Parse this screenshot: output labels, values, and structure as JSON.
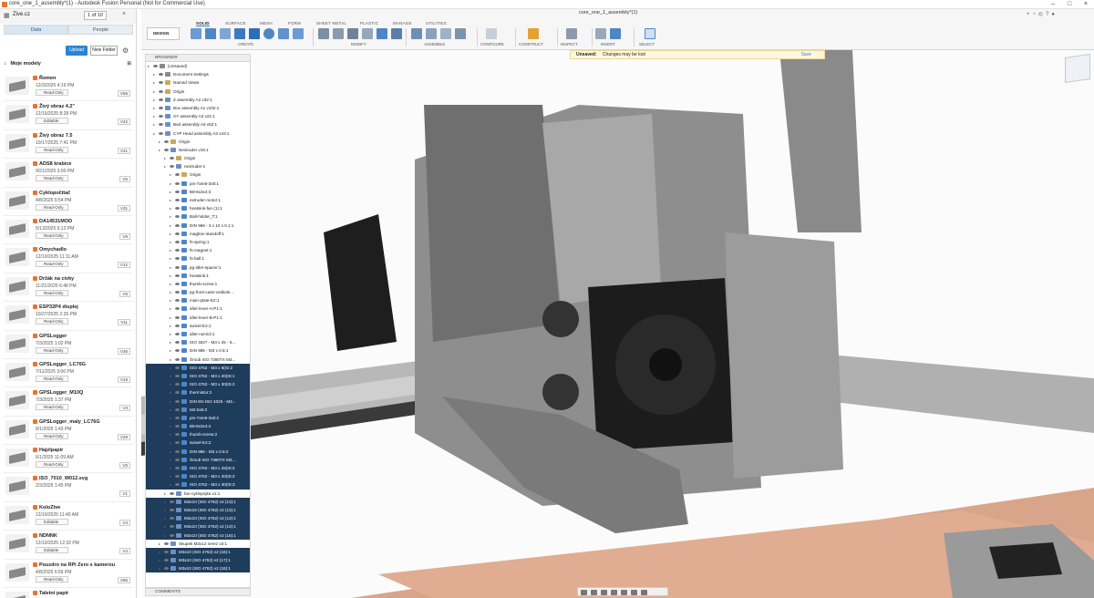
{
  "window": {
    "title": "core_one_1_assembly*(1) - Autodesk Fusion Personal (Not for Commercial Use)",
    "doc_tab": "core_one_1_assembly*(1)"
  },
  "datapanel": {
    "hub": "Zive.cz",
    "pager": "1 of 10",
    "tabs": [
      "Data",
      "People"
    ],
    "upload": "Upload",
    "new_folder": "New Folder",
    "crumb": "Moje modely",
    "items": [
      {
        "name": "Řemen",
        "date": "12/3/2025 4:19 PM",
        "access": "Read-Only",
        "ver": "V66"
      },
      {
        "name": "Živý obraz 4.2\"",
        "date": "12/15/2025 8:28 PM",
        "access": "Editable",
        "ver": "V42"
      },
      {
        "name": "Živý obraz 7.5",
        "date": "10/17/2025 7:41 PM",
        "access": "Read-Only",
        "ver": "V21"
      },
      {
        "name": "ADS8 krabice",
        "date": "9/21/2025 3:00 PM",
        "access": "Read-Only",
        "ver": "V5"
      },
      {
        "name": "Cyklopočítač",
        "date": "4/8/2025 6:54 PM",
        "access": "Read-Only",
        "ver": "V31"
      },
      {
        "name": "DA14531MOD",
        "date": "5/13/2025 6:12 PM",
        "access": "Read-Only",
        "ver": "V9"
      },
      {
        "name": "Omychadlo",
        "date": "12/10/2025 11:11 AM",
        "access": "Read-Only",
        "ver": "V12"
      },
      {
        "name": "Držák na cívky",
        "date": "11/21/2025 6:48 PM",
        "access": "Read-Only",
        "ver": "V6"
      },
      {
        "name": "ESP32P4 displej",
        "date": "10/27/2025 2:26 PM",
        "access": "Read-Only",
        "ver": "V11"
      },
      {
        "name": "GPSLogger",
        "date": "7/3/2025 1:02 PM",
        "access": "Read-Only",
        "ver": "V36"
      },
      {
        "name": "GPSLogger_LC76G",
        "date": "7/11/2025 3:06 PM",
        "access": "Read-Only",
        "ver": "V19"
      },
      {
        "name": "GPSLogger_M10Q",
        "date": "7/3/2025 1:37 PM",
        "access": "Read-Only",
        "ver": "V3"
      },
      {
        "name": "GPSLogger_maly_LC76G",
        "date": "8/1/2025 1:43 PM",
        "access": "Read-Only",
        "ver": "V29"
      },
      {
        "name": "Hajzlpapír",
        "date": "6/1/2025 11:09 AM",
        "access": "Read-Only",
        "ver": "V5"
      },
      {
        "name": "ISO_7010_W012.svg",
        "date": "2/3/2025 1:45 PM",
        "access": "",
        "ver": "V1"
      },
      {
        "name": "KoloZive",
        "date": "12/10/2025 11:40 AM",
        "access": "Editable",
        "ver": "V4"
      },
      {
        "name": "NDNNK",
        "date": "12/10/2025 12:32 PM",
        "access": "Editable",
        "ver": "V4"
      },
      {
        "name": "Pouzdro na RPi Zero s kamerou",
        "date": "4/8/2025 6:55 PM",
        "access": "Read-Only",
        "ver": "V66"
      },
      {
        "name": "Taletní papír",
        "date": "5/17/2025 4:05 PM",
        "access": "",
        "ver": ""
      }
    ]
  },
  "toolbar": {
    "workspace": "DESIGN",
    "tabs": [
      "SOLID",
      "SURFACE",
      "MESH",
      "FORM",
      "SHEET METAL",
      "PLASTIC",
      "MANAGE",
      "UTILITIES"
    ],
    "groups": [
      "CREATE",
      "MODIFY",
      "ASSEMBLE",
      "CONFIGURE",
      "CONSTRUCT",
      "INSPECT",
      "INSERT",
      "SELECT"
    ]
  },
  "banner": {
    "state": "Unsaved:",
    "msg": "Changes may be lost",
    "save": "Save"
  },
  "browser": {
    "title": "BROWSER",
    "comments": "COMMENTS",
    "rows": [
      {
        "label": "(Unsaved)",
        "indent": 0,
        "icon": "root"
      },
      {
        "label": "Document Settings",
        "indent": 1,
        "icon": "gear"
      },
      {
        "label": "Named Views",
        "indent": 1,
        "icon": "folder"
      },
      {
        "label": "Origin",
        "indent": 1,
        "icon": "folder"
      },
      {
        "label": "Z assembly A2 v32:1",
        "indent": 1,
        "icon": "comp"
      },
      {
        "label": "Box assembly A1 v102:1",
        "indent": 1,
        "icon": "comp"
      },
      {
        "label": "XY assembly A3 v21:1",
        "indent": 1,
        "icon": "comp"
      },
      {
        "label": "Bed assembly A5 v52:1",
        "indent": 1,
        "icon": "comp"
      },
      {
        "label": "CYP Head assembly A3 v43:1",
        "indent": 1,
        "icon": "comp"
      },
      {
        "label": "Origin",
        "indent": 2,
        "icon": "folder"
      },
      {
        "label": "Nextruder v16:1",
        "indent": 2,
        "icon": "comp"
      },
      {
        "label": "Origin",
        "indent": 3,
        "icon": "folder"
      },
      {
        "label": "nextruder:1",
        "indent": 3,
        "icon": "comp"
      },
      {
        "label": "Origin",
        "indent": 4,
        "icon": "folder"
      },
      {
        "label": "pin-7am6-3x8:1",
        "indent": 4,
        "icon": "body"
      },
      {
        "label": "B8-8x3x4:3",
        "indent": 4,
        "icon": "body"
      },
      {
        "label": "extruder-motor:1",
        "indent": 4,
        "icon": "body"
      },
      {
        "label": "heatsink-fan (1):1",
        "indent": 4,
        "icon": "body"
      },
      {
        "label": "Ball-holder_T:1",
        "indent": 4,
        "icon": "body"
      },
      {
        "label": "DIN 968 - 3 x 10 x 0.1:1",
        "indent": 4,
        "icon": "body"
      },
      {
        "label": "magbox-standoff:1",
        "indent": 4,
        "icon": "body"
      },
      {
        "label": "fs-spring:1",
        "indent": 4,
        "icon": "body"
      },
      {
        "label": "fs-magnet:1",
        "indent": 4,
        "icon": "body"
      },
      {
        "label": "fs-ball:1",
        "indent": 4,
        "icon": "body"
      },
      {
        "label": "pg-idler-spacer:1",
        "indent": 4,
        "icon": "body"
      },
      {
        "label": "heatsink:1",
        "indent": 4,
        "icon": "body"
      },
      {
        "label": "thumb-screw:1",
        "indent": 4,
        "icon": "body"
      },
      {
        "label": "pg-front-case-votikole...",
        "indent": 4,
        "icon": "body"
      },
      {
        "label": "main-plate-E2:1",
        "indent": 4,
        "icon": "body"
      },
      {
        "label": "idler-lever-A-P1:1",
        "indent": 4,
        "icon": "body"
      },
      {
        "label": "idler-lever-B-P1:1",
        "indent": 4,
        "icon": "body"
      },
      {
        "label": "swivel-E2:1",
        "indent": 4,
        "icon": "body"
      },
      {
        "label": "idler-nut-E2:1",
        "indent": 4,
        "icon": "body"
      },
      {
        "label": "ISO 4027 - M3 x 25 - 6...",
        "indent": 4,
        "icon": "body"
      },
      {
        "label": "DIN 985 - M3 x 0.5:1",
        "indent": 4,
        "icon": "body"
      },
      {
        "label": "Šroub ISO 7380TX M3...",
        "indent": 4,
        "icon": "body"
      },
      {
        "label": "ISO 4762 - M3 x 8(IS:2",
        "indent": 4,
        "icon": "body",
        "sel": true
      },
      {
        "label": "ISO 4762 - M3 x 20(IS:1",
        "indent": 4,
        "icon": "body",
        "sel": true
      },
      {
        "label": "ISO 4762 - M3 x 30(IS:2",
        "indent": 4,
        "icon": "body",
        "sel": true
      },
      {
        "label": "thermistor:2",
        "indent": 4,
        "icon": "body",
        "sel": true
      },
      {
        "label": "DIN EN ISO 4026 - M3...",
        "indent": 4,
        "icon": "body",
        "sel": true
      },
      {
        "label": "M3 5x6:3",
        "indent": 4,
        "icon": "body",
        "sel": true
      },
      {
        "label": "pin-7am6-3x8:2",
        "indent": 4,
        "icon": "body",
        "sel": true
      },
      {
        "label": "B8-8x3x4:4",
        "indent": 4,
        "icon": "body",
        "sel": true
      },
      {
        "label": "thumb-screw:2",
        "indent": 4,
        "icon": "body",
        "sel": true
      },
      {
        "label": "swivel-E2:2",
        "indent": 4,
        "icon": "body",
        "sel": true
      },
      {
        "label": "DIN 985 - M3 x 0.5:2",
        "indent": 4,
        "icon": "body",
        "sel": true
      },
      {
        "label": "Šroub ISO 7380TX M3...",
        "indent": 4,
        "icon": "body",
        "sel": true
      },
      {
        "label": "ISO 4762 - M3 x 25(IS:2",
        "indent": 4,
        "icon": "body",
        "sel": true
      },
      {
        "label": "ISO 4762 - M3 x 20(IS:2",
        "indent": 4,
        "icon": "body",
        "sel": true
      },
      {
        "label": "ISO 4762 - M3 x 30(IS:3",
        "indent": 4,
        "icon": "body",
        "sel": true
      },
      {
        "label": "fan-cyklopojka v1:1",
        "indent": 3,
        "icon": "comp"
      },
      {
        "label": "M3x10 (ISO 4762) v2 (13):1",
        "indent": 3,
        "icon": "comp",
        "sel": true
      },
      {
        "label": "M3x18 (ISO 4762) v2 (13):1",
        "indent": 3,
        "icon": "comp",
        "sel": true
      },
      {
        "label": "M3x10 (ISO 4762) v2 (13):1",
        "indent": 3,
        "icon": "comp",
        "sel": true
      },
      {
        "label": "M3x10 (ISO 4762) v2 (13):1",
        "indent": 3,
        "icon": "comp",
        "sel": true
      },
      {
        "label": "M3x10 (ISO 4762) v2 (15):1",
        "indent": 3,
        "icon": "comp",
        "sel": true
      },
      {
        "label": "Skupek M3x12 nerez v2:1",
        "indent": 2,
        "icon": "comp"
      },
      {
        "label": "M3x10 (ISO 4762) v2 (16):1",
        "indent": 2,
        "icon": "comp",
        "sel": true
      },
      {
        "label": "M3x10 (ISO 4762) v2 (17):1",
        "indent": 2,
        "icon": "comp",
        "sel": true
      },
      {
        "label": "M3x10 (ISO 4762) v2 (18):1",
        "indent": 2,
        "icon": "comp",
        "sel": true
      }
    ]
  }
}
